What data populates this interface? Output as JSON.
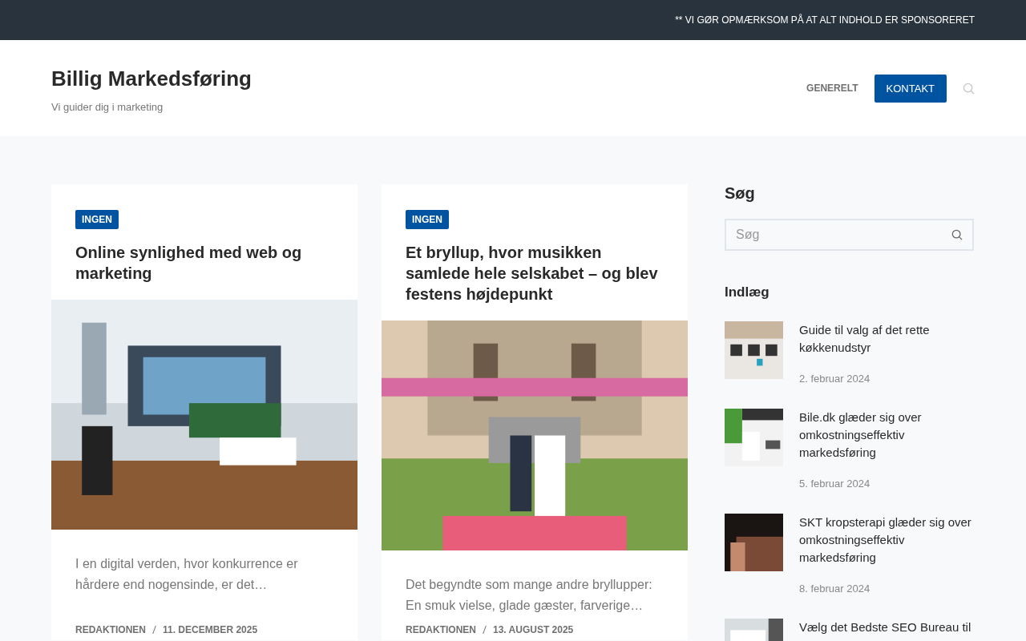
{
  "top_bar": {
    "notice": "** VI GØR OPMÆRKSOM PÅ AT ALT INDHOLD ER SPONSORERET"
  },
  "header": {
    "site_title": "Billig Markedsføring",
    "tagline": "Vi guider dig i marketing",
    "nav": [
      {
        "label": "GENERELT",
        "selected": false
      },
      {
        "label": "KONTAKT",
        "selected": true
      }
    ]
  },
  "posts": [
    {
      "category": "INGEN",
      "title": "Online synlighed med web og marketing",
      "excerpt": "I en digital verden, hvor konkurrence er hårdere end nogensinde, er det…",
      "author": "REDAKTIONEN",
      "date": "11. DECEMBER 2025"
    },
    {
      "category": "INGEN",
      "title": "Et bryllup, hvor musikken samlede hele selskabet – og blev festens højdepunkt",
      "excerpt": "Det begyndte som mange andre bryllupper: En smuk vielse, glade gæster, farverige…",
      "author": "REDAKTIONEN",
      "date": "13. AUGUST 2025"
    }
  ],
  "sidebar": {
    "search_heading": "Søg",
    "search": {
      "placeholder": "Søg"
    },
    "posts_heading": "Indlæg",
    "recent_posts": [
      {
        "title": "Guide til valg af det rette køkkenudstyr",
        "date": "2. februar 2024"
      },
      {
        "title": "Bile.dk glæder sig over omkostningseffektiv markedsføring",
        "date": "5. februar 2024"
      },
      {
        "title": "SKT kropsterapi glæder sig over omkostningseffektiv markedsføring",
        "date": "8. februar 2024"
      },
      {
        "title": "Vælg det Bedste SEO Bureau til"
      }
    ]
  }
}
